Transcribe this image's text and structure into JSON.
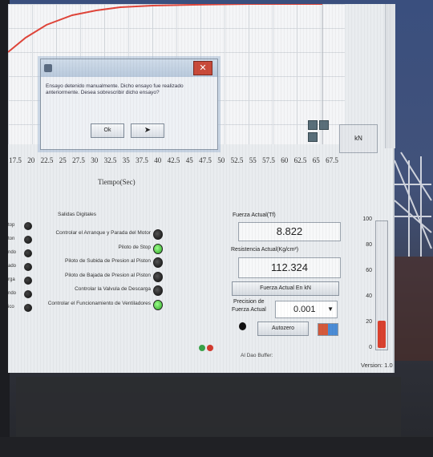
{
  "dialog": {
    "message": "Ensayo detenido manualmente. Dicho ensayo fue realizado anteriormente. Desea sobrescribir dicho ensayo?",
    "ok_label": "Ok",
    "cancel_label": "",
    "close_glyph": "✕"
  },
  "graph": {
    "x_ticks": [
      "17.5",
      "20",
      "22.5",
      "25",
      "27.5",
      "30",
      "32.5",
      "35",
      "37.5",
      "40",
      "42.5",
      "45",
      "47.5",
      "50",
      "52.5",
      "55",
      "57.5",
      "60",
      "62.5",
      "65",
      "67.5"
    ],
    "x_axis_title": "Tiempo(Sec)",
    "line_color": "#e0453a"
  },
  "kn_button_label": "kN",
  "digital_outputs": {
    "title": "Salidas Digitales",
    "rows": [
      {
        "label": "Controlar el Arranque y Parada del Motor",
        "state": "off"
      },
      {
        "label": "Piloto de Stop",
        "state": "on"
      },
      {
        "label": "Piloto de Subida de Presion al Piston",
        "state": "off"
      },
      {
        "label": "Piloto de Bajada de Presion al Piston",
        "state": "off"
      },
      {
        "label": "Controlar la Valvula de Descarga",
        "state": "off"
      },
      {
        "label": "Controlar el Funcionamiento de Ventiladores",
        "state": "on"
      }
    ],
    "left_labels": [
      "top",
      "ton",
      "ndo",
      "ado",
      "rga",
      "ndo",
      "ico"
    ]
  },
  "readouts": {
    "force_label": "Fuerza Actual(Tf)",
    "force_value": "8.822",
    "resistance_label": "Resistencia Actual(Kg/cm²)",
    "resistance_value": "112.324",
    "kn_button": "Fuerza Actual En kN",
    "precision_label_1": "Precision de",
    "precision_label_2": "Fuerza Actual",
    "precision_value": "0.001",
    "autozero_label": "Autozero",
    "status_text": "Al Dao Buffer:",
    "version": "Version: 1.0"
  },
  "gauge": {
    "ticks": [
      "100",
      "80",
      "60",
      "40",
      "20",
      "0"
    ],
    "level": 0.22,
    "fill_color": "#d9412f"
  }
}
